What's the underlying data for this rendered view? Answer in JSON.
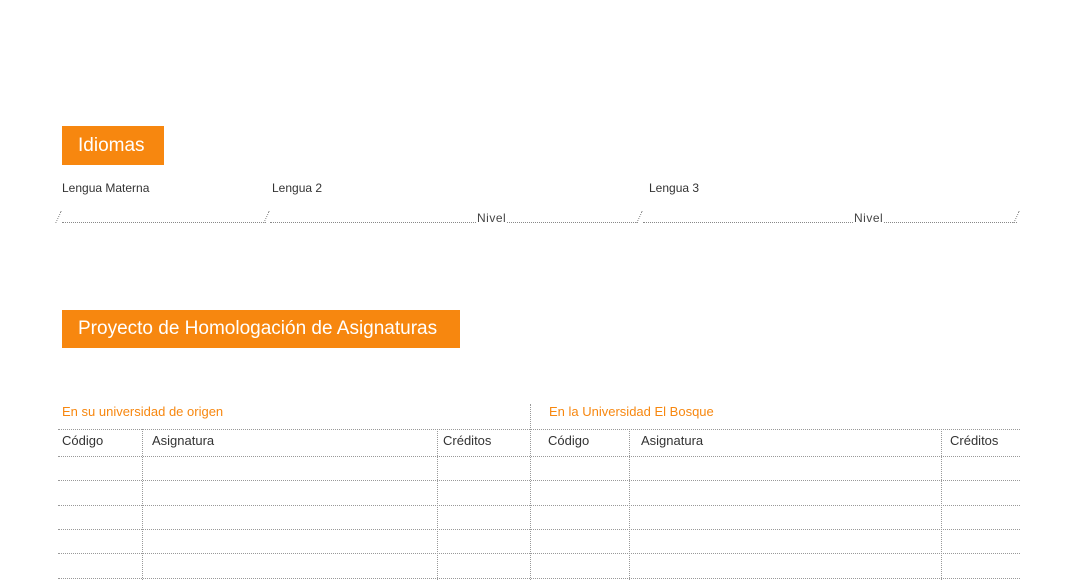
{
  "idiomas": {
    "title": "Idiomas",
    "lengua_materna_label": "Lengua Materna",
    "lengua_2_label": "Lengua 2",
    "lengua_3_label": "Lengua 3",
    "nivel_label_2": "Nivel",
    "nivel_label_3": "Nivel"
  },
  "proyecto": {
    "title": "Proyecto de Homologación de Asignaturas",
    "origin_heading": "En  su universidad de origen",
    "bosque_heading": "En la Universidad El Bosque",
    "origin_columns": [
      "Código",
      "Asignatura",
      "Créditos"
    ],
    "bosque_columns": [
      "Código",
      "Asignatura",
      "Créditos"
    ],
    "empty_row_count": 5
  },
  "colors": {
    "accent": "#f7870f"
  }
}
